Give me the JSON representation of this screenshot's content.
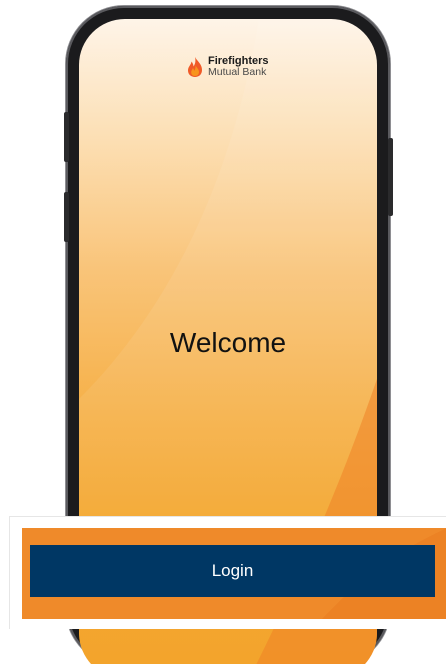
{
  "brand": {
    "name_line1": "Firefighters",
    "name_line2": "Mutual Bank",
    "logo_icon": "flame-icon",
    "flame_colors": [
      "#f05a28",
      "#f7941d"
    ]
  },
  "screen": {
    "heading": "Welcome",
    "gradient_top": "#fef4e8",
    "gradient_bottom": "#f29c1a"
  },
  "login": {
    "button_label": "Login",
    "button_color": "#003764",
    "strip_color": "#ef8a2a"
  }
}
